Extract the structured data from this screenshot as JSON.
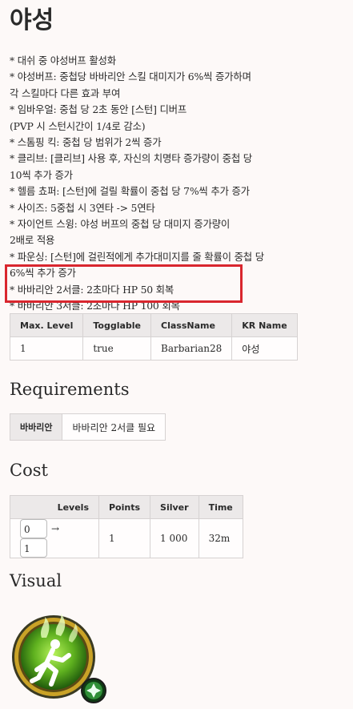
{
  "title": "야성",
  "description": [
    "* 대쉬 중 야성버프 활성화",
    "* 야성버프: 중첩당 바바리안 스킬 대미지가 6%씩 증가하며",
    "각 스킬마다 다른 효과 부여",
    "* 임바우얼: 중첩 당 2초 동안 [스턴] 디버프",
    "(PVP 시 스턴시간이 1/4로 감소)",
    "* 스톰핑 킥: 중첩 당 범위가 2씩 증가",
    "* 클리브: [클리브] 사용 후, 자신의 치명타 증가량이 중첩 당",
    "10씩 추가 증가",
    "* 헬름 쵸퍼: [스턴]에 걸릴 확률이 중첩 당 7%씩 추가 증가",
    "* 사이즈: 5중첩 시 3연타 -> 5연타",
    "* 자이언트 스윙: 야성 버프의 중첩 당 대미지 증가량이",
    "2배로 적용",
    "* 파운싱: [스턴]에 걸린적에게 추가대미지를 줄 확률이 중첩 당",
    "6%씩 추가 증가",
    "* 바바리안 2서클: 2초마다 HP 50 회복",
    "* 바바리안 3서클: 2초마다 HP 100 회복"
  ],
  "info_table": {
    "headers": [
      "Max. Level",
      "Togglable",
      "ClassName",
      "KR Name"
    ],
    "row": [
      "1",
      "true",
      "Barbarian28",
      "야성"
    ]
  },
  "requirements": {
    "heading": "Requirements",
    "key": "바바리안",
    "value": "바바리안 2서클 필요"
  },
  "cost": {
    "heading": "Cost",
    "headers": [
      "Levels",
      "Points",
      "Silver",
      "Time"
    ],
    "level_from": "0",
    "arrow": "→",
    "level_to": "1",
    "points": "1",
    "silver": "1 000",
    "time": "32m"
  },
  "visual": {
    "heading": "Visual"
  },
  "colors": {
    "highlight": "#d9262e",
    "emblem_green": "#5fb11f",
    "emblem_gold": "#c9a227"
  }
}
